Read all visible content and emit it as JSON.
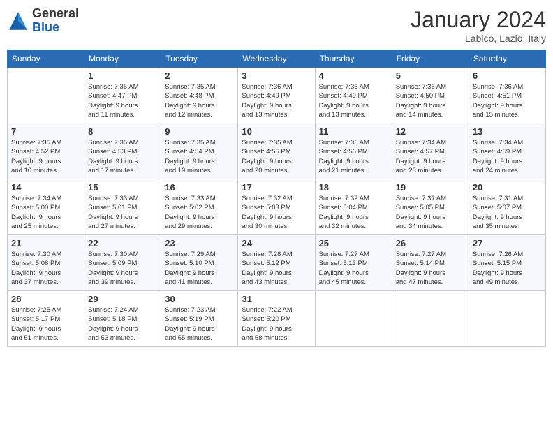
{
  "logo": {
    "general": "General",
    "blue": "Blue"
  },
  "title": "January 2024",
  "location": "Labico, Lazio, Italy",
  "days_of_week": [
    "Sunday",
    "Monday",
    "Tuesday",
    "Wednesday",
    "Thursday",
    "Friday",
    "Saturday"
  ],
  "weeks": [
    [
      {
        "day": "",
        "info": ""
      },
      {
        "day": "1",
        "info": "Sunrise: 7:35 AM\nSunset: 4:47 PM\nDaylight: 9 hours\nand 11 minutes."
      },
      {
        "day": "2",
        "info": "Sunrise: 7:35 AM\nSunset: 4:48 PM\nDaylight: 9 hours\nand 12 minutes."
      },
      {
        "day": "3",
        "info": "Sunrise: 7:36 AM\nSunset: 4:49 PM\nDaylight: 9 hours\nand 13 minutes."
      },
      {
        "day": "4",
        "info": "Sunrise: 7:36 AM\nSunset: 4:49 PM\nDaylight: 9 hours\nand 13 minutes."
      },
      {
        "day": "5",
        "info": "Sunrise: 7:36 AM\nSunset: 4:50 PM\nDaylight: 9 hours\nand 14 minutes."
      },
      {
        "day": "6",
        "info": "Sunrise: 7:36 AM\nSunset: 4:51 PM\nDaylight: 9 hours\nand 15 minutes."
      }
    ],
    [
      {
        "day": "7",
        "info": "Sunrise: 7:35 AM\nSunset: 4:52 PM\nDaylight: 9 hours\nand 16 minutes."
      },
      {
        "day": "8",
        "info": "Sunrise: 7:35 AM\nSunset: 4:53 PM\nDaylight: 9 hours\nand 17 minutes."
      },
      {
        "day": "9",
        "info": "Sunrise: 7:35 AM\nSunset: 4:54 PM\nDaylight: 9 hours\nand 19 minutes."
      },
      {
        "day": "10",
        "info": "Sunrise: 7:35 AM\nSunset: 4:55 PM\nDaylight: 9 hours\nand 20 minutes."
      },
      {
        "day": "11",
        "info": "Sunrise: 7:35 AM\nSunset: 4:56 PM\nDaylight: 9 hours\nand 21 minutes."
      },
      {
        "day": "12",
        "info": "Sunrise: 7:34 AM\nSunset: 4:57 PM\nDaylight: 9 hours\nand 23 minutes."
      },
      {
        "day": "13",
        "info": "Sunrise: 7:34 AM\nSunset: 4:59 PM\nDaylight: 9 hours\nand 24 minutes."
      }
    ],
    [
      {
        "day": "14",
        "info": "Sunrise: 7:34 AM\nSunset: 5:00 PM\nDaylight: 9 hours\nand 25 minutes."
      },
      {
        "day": "15",
        "info": "Sunrise: 7:33 AM\nSunset: 5:01 PM\nDaylight: 9 hours\nand 27 minutes."
      },
      {
        "day": "16",
        "info": "Sunrise: 7:33 AM\nSunset: 5:02 PM\nDaylight: 9 hours\nand 29 minutes."
      },
      {
        "day": "17",
        "info": "Sunrise: 7:32 AM\nSunset: 5:03 PM\nDaylight: 9 hours\nand 30 minutes."
      },
      {
        "day": "18",
        "info": "Sunrise: 7:32 AM\nSunset: 5:04 PM\nDaylight: 9 hours\nand 32 minutes."
      },
      {
        "day": "19",
        "info": "Sunrise: 7:31 AM\nSunset: 5:05 PM\nDaylight: 9 hours\nand 34 minutes."
      },
      {
        "day": "20",
        "info": "Sunrise: 7:31 AM\nSunset: 5:07 PM\nDaylight: 9 hours\nand 35 minutes."
      }
    ],
    [
      {
        "day": "21",
        "info": "Sunrise: 7:30 AM\nSunset: 5:08 PM\nDaylight: 9 hours\nand 37 minutes."
      },
      {
        "day": "22",
        "info": "Sunrise: 7:30 AM\nSunset: 5:09 PM\nDaylight: 9 hours\nand 39 minutes."
      },
      {
        "day": "23",
        "info": "Sunrise: 7:29 AM\nSunset: 5:10 PM\nDaylight: 9 hours\nand 41 minutes."
      },
      {
        "day": "24",
        "info": "Sunrise: 7:28 AM\nSunset: 5:12 PM\nDaylight: 9 hours\nand 43 minutes."
      },
      {
        "day": "25",
        "info": "Sunrise: 7:27 AM\nSunset: 5:13 PM\nDaylight: 9 hours\nand 45 minutes."
      },
      {
        "day": "26",
        "info": "Sunrise: 7:27 AM\nSunset: 5:14 PM\nDaylight: 9 hours\nand 47 minutes."
      },
      {
        "day": "27",
        "info": "Sunrise: 7:26 AM\nSunset: 5:15 PM\nDaylight: 9 hours\nand 49 minutes."
      }
    ],
    [
      {
        "day": "28",
        "info": "Sunrise: 7:25 AM\nSunset: 5:17 PM\nDaylight: 9 hours\nand 51 minutes."
      },
      {
        "day": "29",
        "info": "Sunrise: 7:24 AM\nSunset: 5:18 PM\nDaylight: 9 hours\nand 53 minutes."
      },
      {
        "day": "30",
        "info": "Sunrise: 7:23 AM\nSunset: 5:19 PM\nDaylight: 9 hours\nand 55 minutes."
      },
      {
        "day": "31",
        "info": "Sunrise: 7:22 AM\nSunset: 5:20 PM\nDaylight: 9 hours\nand 58 minutes."
      },
      {
        "day": "",
        "info": ""
      },
      {
        "day": "",
        "info": ""
      },
      {
        "day": "",
        "info": ""
      }
    ]
  ]
}
